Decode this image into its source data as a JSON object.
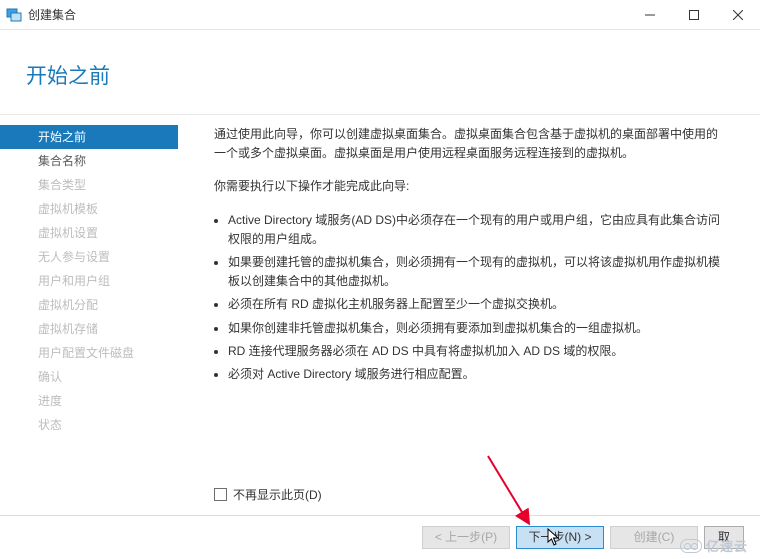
{
  "window": {
    "title": "创建集合",
    "controls": {
      "minimize": "–",
      "maximize": "",
      "close": ""
    }
  },
  "header": {
    "title": "开始之前"
  },
  "sidebar": {
    "items": [
      {
        "label": "开始之前",
        "active": true,
        "enabled": true
      },
      {
        "label": "集合名称",
        "active": false,
        "enabled": true
      },
      {
        "label": "集合类型",
        "active": false,
        "enabled": false
      },
      {
        "label": "虚拟机模板",
        "active": false,
        "enabled": false
      },
      {
        "label": "虚拟机设置",
        "active": false,
        "enabled": false
      },
      {
        "label": "无人参与设置",
        "active": false,
        "enabled": false
      },
      {
        "label": "用户和用户组",
        "active": false,
        "enabled": false
      },
      {
        "label": "虚拟机分配",
        "active": false,
        "enabled": false
      },
      {
        "label": "虚拟机存储",
        "active": false,
        "enabled": false
      },
      {
        "label": "用户配置文件磁盘",
        "active": false,
        "enabled": false
      },
      {
        "label": "确认",
        "active": false,
        "enabled": false
      },
      {
        "label": "进度",
        "active": false,
        "enabled": false
      },
      {
        "label": "状态",
        "active": false,
        "enabled": false
      }
    ]
  },
  "content": {
    "intro": "通过使用此向导，你可以创建虚拟桌面集合。虚拟桌面集合包含基于虚拟机的桌面部署中使用的一个或多个虚拟桌面。虚拟桌面是用户使用远程桌面服务远程连接到的虚拟机。",
    "lead": "你需要执行以下操作才能完成此向导:",
    "bullets": [
      "Active Directory 域服务(AD DS)中必须存在一个现有的用户或用户组，它由应具有此集合访问权限的用户组成。",
      "如果要创建托管的虚拟机集合，则必须拥有一个现有的虚拟机，可以将该虚拟机用作虚拟机模板以创建集合中的其他虚拟机。",
      "必须在所有 RD 虚拟化主机服务器上配置至少一个虚拟交换机。",
      "如果你创建非托管虚拟机集合，则必须拥有要添加到虚拟机集合的一组虚拟机。",
      "RD 连接代理服务器必须在 AD DS 中具有将虚拟机加入 AD DS 域的权限。",
      "必须对 Active Directory 域服务进行相应配置。"
    ],
    "dont_show_label": "不再显示此页(D)"
  },
  "buttons": {
    "prev": "< 上一步(P)",
    "next": "下一步(N) >",
    "create": "创建(C)",
    "cancel": "取"
  },
  "watermark": {
    "text": "亿速云"
  }
}
